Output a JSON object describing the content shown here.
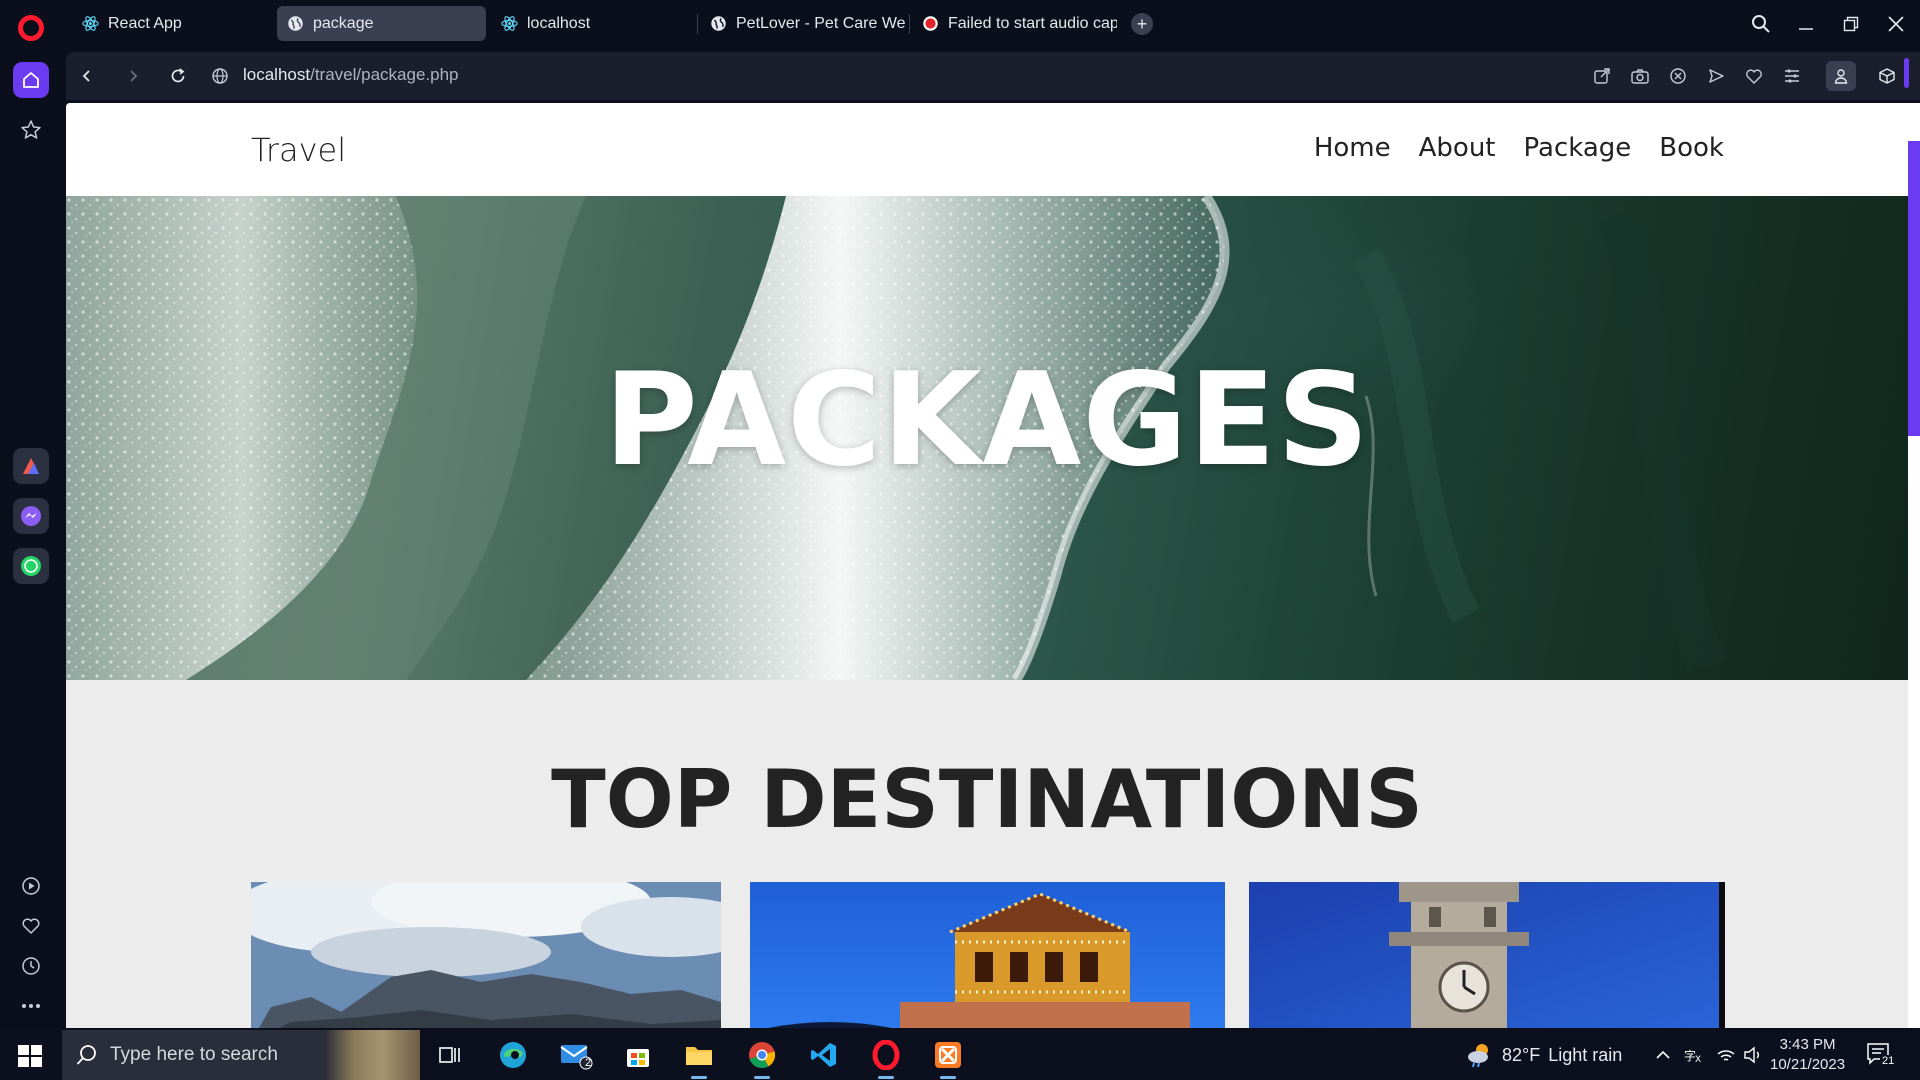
{
  "browser": {
    "tabs": [
      {
        "label": "React App",
        "icon": "react-icon",
        "active": false
      },
      {
        "label": "package",
        "icon": "globe-icon",
        "active": true
      },
      {
        "label": "localhost",
        "icon": "react-icon",
        "active": false
      },
      {
        "label": "PetLover - Pet Care Websi",
        "icon": "globe-icon",
        "active": false
      },
      {
        "label": "Failed to start audio captu",
        "icon": "record-icon",
        "active": false
      }
    ],
    "address": {
      "host": "localhost",
      "path": "/travel/package.php"
    },
    "accent_color": "#6b3bf2"
  },
  "page": {
    "brand": "Travel",
    "nav": [
      "Home",
      "About",
      "Package",
      "Book"
    ],
    "hero_title": "PACKAGES",
    "section_title": "TOP DESTINATIONS"
  },
  "taskbar": {
    "search_placeholder": "Type here to search",
    "mail_badge": "2",
    "weather": {
      "temp": "82°F",
      "condition": "Light rain"
    },
    "time": "3:43 PM",
    "date": "10/21/2023",
    "notifications": "21"
  }
}
